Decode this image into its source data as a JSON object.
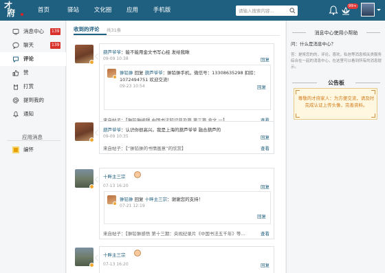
{
  "topbar": {
    "logo_top": "才",
    "logo_bottom": "府",
    "nav": [
      "首页",
      "驿站",
      "文化圈",
      "应用",
      "手机版"
    ],
    "search_placeholder": "请输入搜索内容...",
    "notifications_count": "99+"
  },
  "sidebar": {
    "items": [
      {
        "label": "消息中心",
        "count": "139",
        "icon": "message-center-icon"
      },
      {
        "label": "聊天",
        "count": "139",
        "icon": "chat-icon"
      },
      {
        "label": "评论",
        "count": "",
        "icon": "comment-icon"
      },
      {
        "label": "赞",
        "count": "",
        "icon": "thumbs-up-icon"
      },
      {
        "label": "打赏",
        "count": "",
        "icon": "reward-icon"
      },
      {
        "label": "提到我的",
        "count": "",
        "icon": "at-icon"
      },
      {
        "label": "通知",
        "count": "",
        "icon": "bell-icon"
      }
    ],
    "section_title": "应用消息",
    "app_item": "编怀"
  },
  "main": {
    "header": "收到的评论",
    "count": "共31条",
    "reply_action": "回复",
    "view_action": "查看",
    "reply_word": "回复",
    "from_post": "来自帖子：",
    "comments": [
      {
        "user": "葫芦爷爷",
        "text": "：能不能用金文书写心经 发给我瞅",
        "time": "09-09 10:38",
        "reply_user": "翀铅翀",
        "reply_target": "葫芦爷爷",
        "reply_text": "：翀铅翀手机，微信号：13308635298 扣扣：1072494751 欢迎交流!",
        "reply_time": "09-23 10:54",
        "post": "【翀铅翀编辑 中国书法知识普及篇 第三篇 金文 一】"
      },
      {
        "user": "葫芦爷爷",
        "text": "：认识你很高兴。我是上海的葫芦爷爷 融合葫芦的",
        "time": "09-09 10:35",
        "post": "【“翀铅翀的书情画意”的欣赏】"
      },
      {
        "user": "十畔主三宗",
        "text": "",
        "time": "07-13 16:20",
        "reply_user": "翀铅翀",
        "reply_target": "十畔主三宗",
        "reply_text": "：谢谢您的支持！",
        "reply_time": "07-21 12:19",
        "post": "【翀铅翀感悟 第十三期：央视纪录片《中国书法五千年》等..."
      },
      {
        "user": "十畔主三宗",
        "text": "",
        "time": "07-13 16:20"
      }
    ]
  },
  "right": {
    "help_title": "消息中心使用小帮助",
    "question": "问：什么是消息中心？",
    "answer": "答：是将您的的，评论，喜欢，私信等消息相关类服务综合在一起的消息中心，在这里可以看到所有的消息提示。",
    "notice_title": "公告板",
    "notice_text": "尊敬的才府家人：为方便交流，请及时完成认证上传头像，完善资料。"
  }
}
